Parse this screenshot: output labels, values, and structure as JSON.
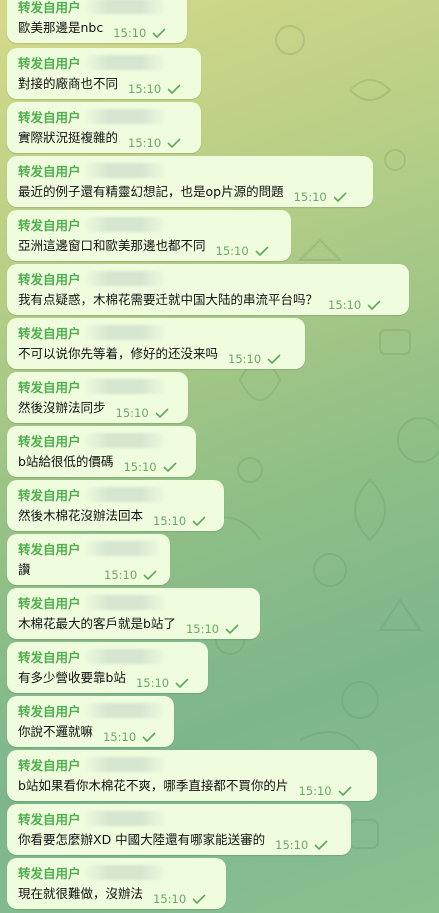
{
  "theme": {
    "bubble": "#effdde",
    "sender_color": "#4fae4e",
    "time_color": "#6aaa64"
  },
  "messages": [
    {
      "sender": "转发自用户",
      "text": "歐美那邊是nbc",
      "time": "15:10"
    },
    {
      "sender": "转发自用户",
      "text": "對接的廠商也不同",
      "time": "15:10"
    },
    {
      "sender": "转发自用户",
      "text": "實際狀況挺複雜的",
      "time": "15:10"
    },
    {
      "sender": "转发自用户",
      "text": "最近的例子還有精靈幻想記，也是op片源的問題",
      "time": "15:10"
    },
    {
      "sender": "转发自用户",
      "text": "亞洲這邊窗口和歐美那邊也都不同",
      "time": "15:10"
    },
    {
      "sender": "转发自用户",
      "text": "我有点疑惑，木棉花需要迁就中国大陆的串流平台吗？",
      "time": "15:10"
    },
    {
      "sender": "转发自用户",
      "text": "不可以说你先等着，修好的还没来吗",
      "time": "15:10"
    },
    {
      "sender": "转发自用户",
      "text": "然後沒辦法同步",
      "time": "15:10"
    },
    {
      "sender": "转发自用户",
      "text": "b站給很低的價碼",
      "time": "15:10"
    },
    {
      "sender": "转发自用户",
      "text": "然後木棉花沒辦法回本",
      "time": "15:10"
    },
    {
      "sender": "转发自用户",
      "text": "讚",
      "time": "15:10"
    },
    {
      "sender": "转发自用户",
      "text": "木棉花最大的客戶就是b站了",
      "time": "15:10"
    },
    {
      "sender": "转发自用户",
      "text": "有多少營收要靠b站",
      "time": "15:10"
    },
    {
      "sender": "转发自用户",
      "text": "你說不邏就嘛",
      "time": "15:10"
    },
    {
      "sender": "转发自用户",
      "text": "b站如果看你木棉花不爽，哪季直接都不買你的片",
      "time": "15:10"
    },
    {
      "sender": "转发自用户",
      "text": "你看要怎麼辦XD 中國大陸還有哪家能送審的",
      "time": "15:10"
    },
    {
      "sender": "转发自用户",
      "text": "現在就很難做，沒辦法",
      "time": "15:10"
    }
  ]
}
